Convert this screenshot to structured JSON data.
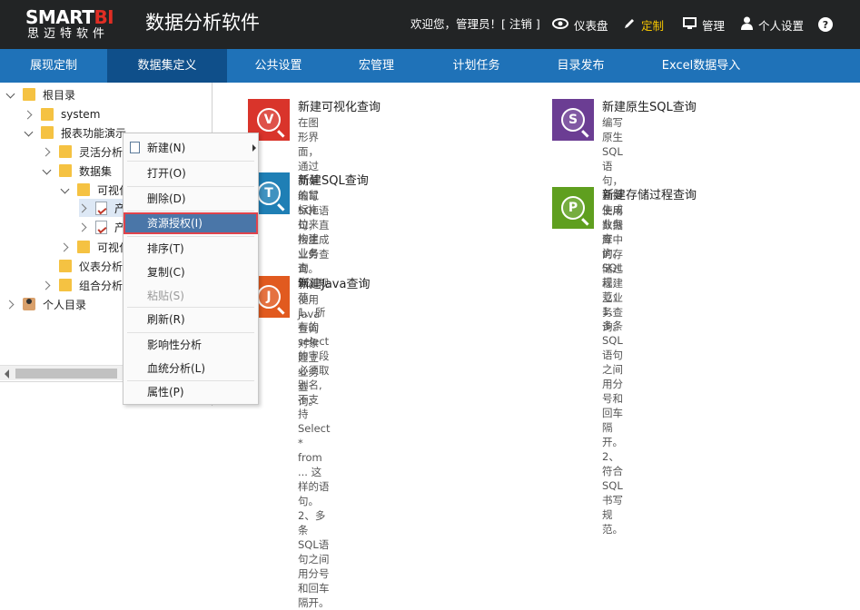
{
  "header": {
    "logo_brand_a": "SMART",
    "logo_brand_b": "BI",
    "logo_sub": "思迈特软件",
    "app_title": "数据分析软件",
    "welcome": "欢迎您，管理员！[ 注销 ]",
    "links": [
      {
        "label": "仪表盘",
        "icon": "eye-icon"
      },
      {
        "label": "定制",
        "icon": "pencil-icon",
        "active": true
      },
      {
        "label": "管理",
        "icon": "monitor-icon"
      },
      {
        "label": "个人设置",
        "icon": "user-icon"
      },
      {
        "label": "?",
        "icon": "help-icon"
      }
    ]
  },
  "nav": {
    "tabs": [
      "展现定制",
      "数据集定义",
      "公共设置",
      "宏管理",
      "计划任务",
      "目录发布",
      "Excel数据导入"
    ],
    "active_index": 1
  },
  "tree": {
    "items": [
      {
        "label": "根目录",
        "type": "folder",
        "expanded": true
      },
      {
        "label": "system",
        "type": "folder",
        "expanded": false
      },
      {
        "label": "报表功能演示",
        "type": "folder",
        "expanded": true
      },
      {
        "label": "灵活分析",
        "type": "folder"
      },
      {
        "label": "数据集",
        "type": "folder",
        "expanded": true
      },
      {
        "label": "可视化",
        "type": "folder",
        "expanded": true
      },
      {
        "label": "产",
        "type": "query",
        "selected": true
      },
      {
        "label": "产",
        "type": "query"
      },
      {
        "label": "可视化",
        "type": "folder"
      },
      {
        "label": "仪表分析",
        "type": "folder"
      },
      {
        "label": "组合分析",
        "type": "folder"
      },
      {
        "label": "个人目录",
        "type": "user"
      }
    ]
  },
  "cards": [
    {
      "title": "新建可视化查询",
      "letter": "V",
      "color": "#d9342b",
      "desc": [
        "在图形界面，通过简单的鼠标拖拉来构建业务",
        "查询。"
      ]
    },
    {
      "title": "新建原生SQL查询",
      "letter": "S",
      "color": "#6b3d93",
      "desc": [
        "编写原生SQL语句，直接生成业务查询。SQL",
        "规范：1、多条SQL语句之间用分号和回车隔",
        "开。 2、符合SQL书写规范。"
      ]
    },
    {
      "title": "新建SQL查询",
      "letter": "T",
      "color": "#1f7fb5",
      "desc": [
        "编写SQL语句，直接生成业务查询。SQL规",
        "范：1、所有的select的字段必须取别名,不支",
        "持Select * from ... 这样的语句。 2、多条",
        "SQL语句之间用分号和回车隔开。"
      ]
    },
    {
      "title": "新建存储过程查询",
      "letter": "P",
      "color": "#5f9f1f",
      "desc": [
        "使用数据库中的存储过程建立业务查询。"
      ]
    },
    {
      "title": "新建Java查询",
      "letter": "J",
      "color": "#e15a1f",
      "desc": [
        "使用Java查询对象建立业务查询。"
      ]
    }
  ],
  "context_menu": {
    "items": [
      {
        "label": "新建(N)",
        "submenu": true
      },
      {
        "label": "打开(O)"
      },
      {
        "label": "删除(D)"
      },
      {
        "label": "资源授权(I)",
        "hover": true
      },
      {
        "label": "排序(T)"
      },
      {
        "label": "复制(C)"
      },
      {
        "label": "粘贴(S)",
        "disabled": true
      },
      {
        "label": "刷新(R)"
      },
      {
        "label": "影响性分析"
      },
      {
        "label": "血统分析(L)"
      },
      {
        "label": "属性(P)"
      }
    ]
  }
}
